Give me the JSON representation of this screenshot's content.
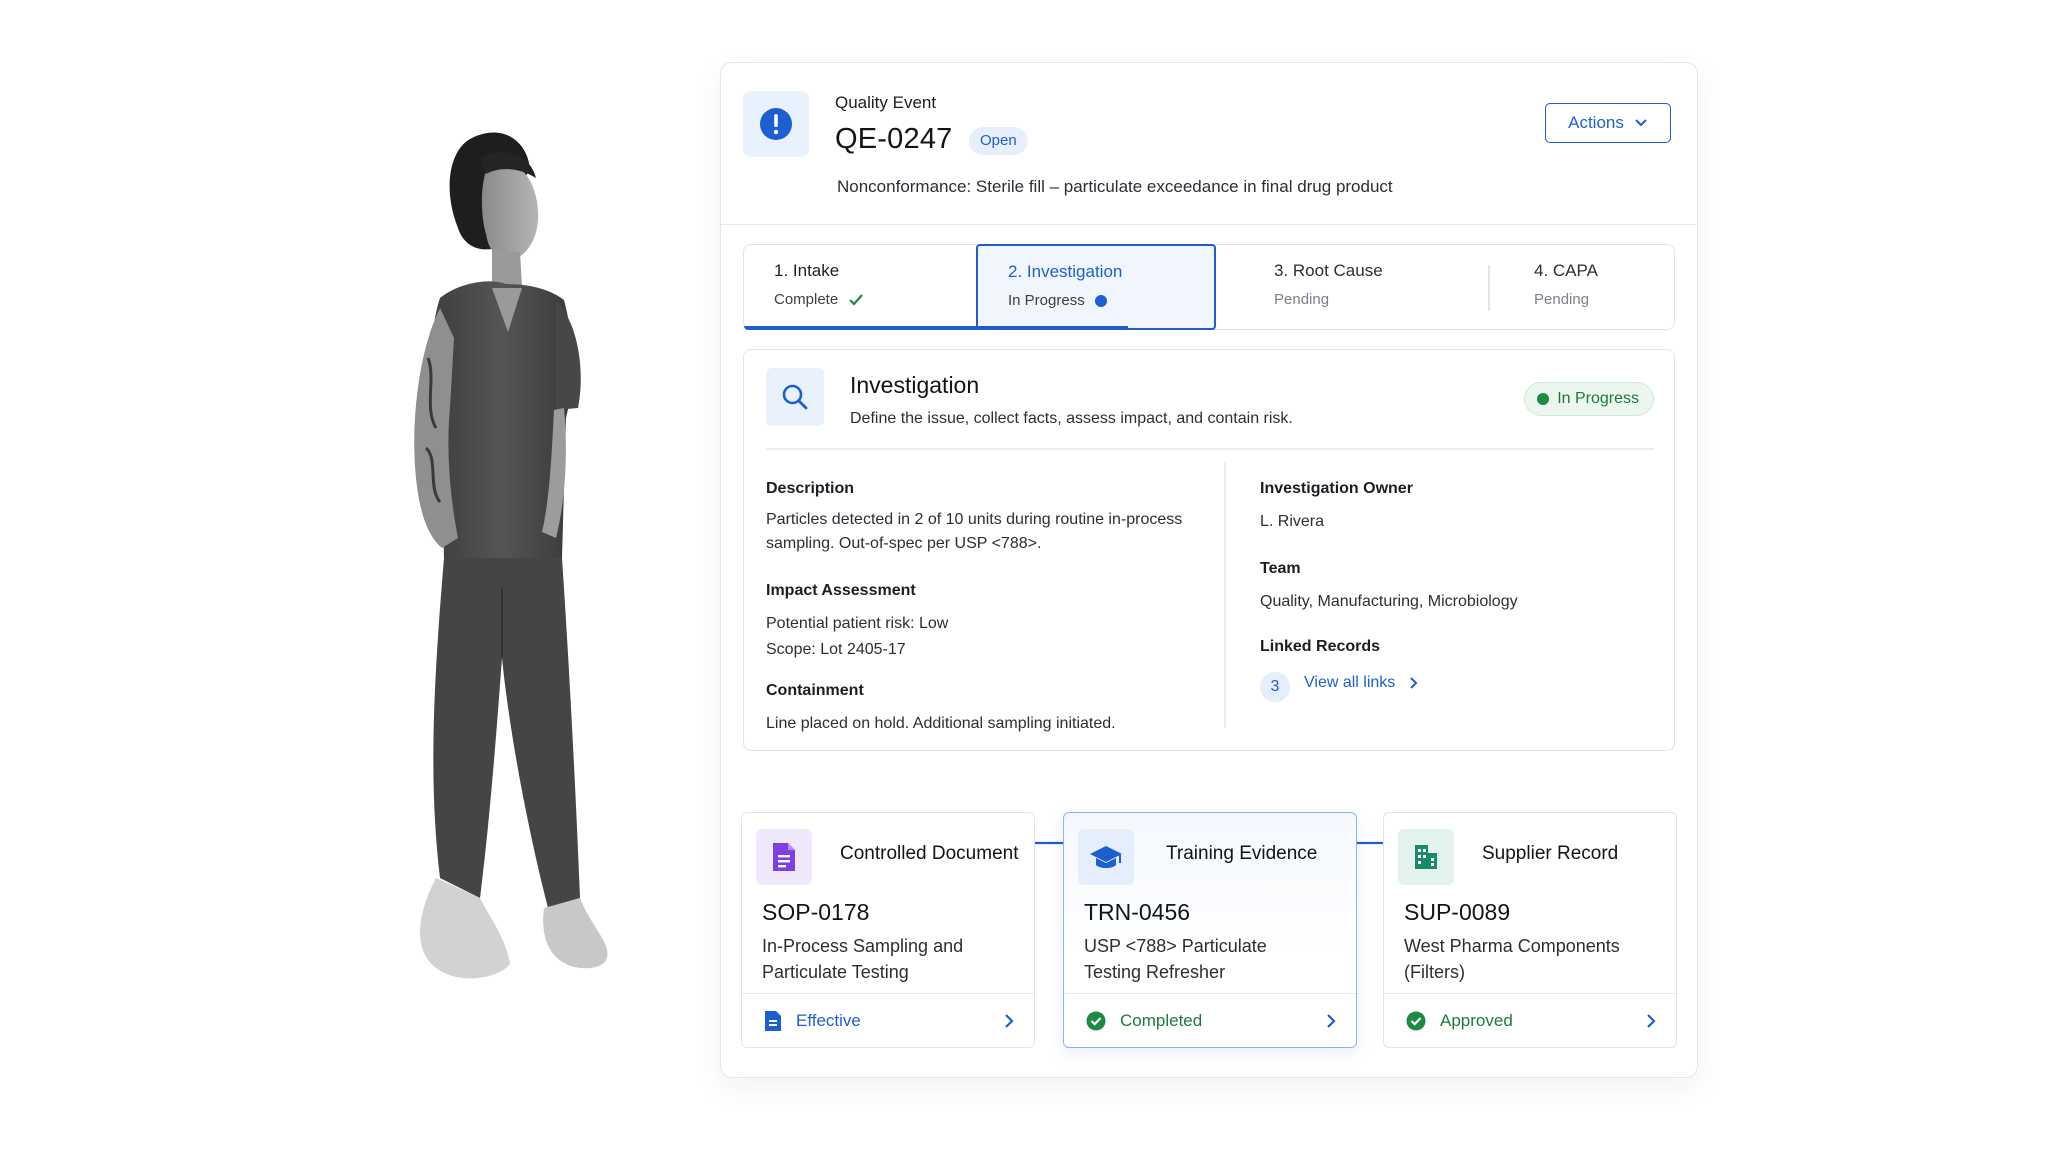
{
  "event": {
    "label": "Quality Event",
    "id": "QE-0247",
    "status": "Open",
    "description": "Nonconformance: Sterile fill – particulate exceedance in final drug product",
    "actions_label": "Actions"
  },
  "steps": [
    {
      "title": "1. Intake",
      "status": "Complete"
    },
    {
      "title": "2. Investigation",
      "status": "In Progress"
    },
    {
      "title": "3. Root Cause",
      "status": "Pending"
    },
    {
      "title": "4. CAPA",
      "status": "Pending"
    }
  ],
  "investigation": {
    "title": "Investigation",
    "subtitle": "Define the issue, collect facts, assess impact, and contain risk.",
    "status": "In Progress",
    "description_label": "Description",
    "description_lines": [
      "Particles detected in 2 of 10 units during routine in-process",
      "sampling. Out-of-spec per USP <788>."
    ],
    "impact_label": "Impact Assessment",
    "impact_lines": [
      "Potential patient risk: Low",
      "Scope: Lot 2405-17"
    ],
    "containment_label": "Containment",
    "containment_text": "Line placed on hold. Additional sampling initiated.",
    "owner_label": "Investigation Owner",
    "owner": "L. Rivera",
    "team_label": "Team",
    "team": "Quality, Manufacturing, Microbiology",
    "linked_label": "Linked Records",
    "linked_count": "3",
    "view_links": "View all links"
  },
  "records": [
    {
      "type": "Controlled Document",
      "id": "SOP-0178",
      "name_lines": [
        "In-Process Sampling and",
        "Particulate Testing"
      ],
      "status": "Effective",
      "icon": "document-icon",
      "color": "#7b3fe4"
    },
    {
      "type": "Training Evidence",
      "id": "TRN-0456",
      "name_lines": [
        "USP <788> Particulate",
        "Testing Refresher"
      ],
      "status": "Completed",
      "icon": "graduation-cap-icon",
      "color": "#1d5fd1"
    },
    {
      "type": "Supplier Record",
      "id": "SUP-0089",
      "name_lines": [
        "West Pharma Components",
        "(Filters)"
      ],
      "status": "Approved",
      "icon": "building-icon",
      "color": "#1b8a6b"
    }
  ],
  "colors": {
    "accent": "#1d5fd1",
    "success": "#1f7a3a"
  }
}
